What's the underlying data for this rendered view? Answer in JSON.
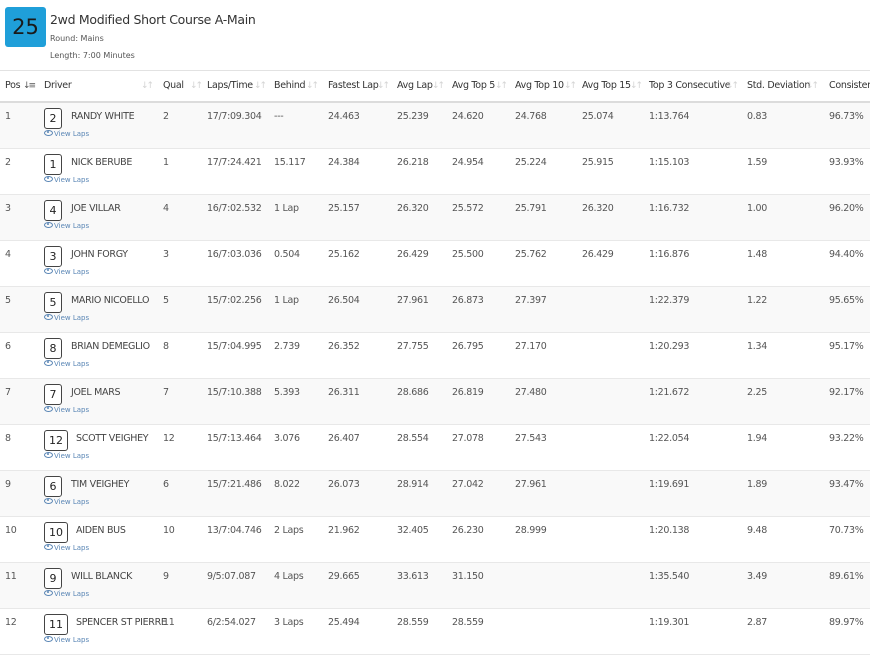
{
  "race": {
    "number": "25",
    "title": "2wd Modified Short Course A-Main",
    "round": "Round: Mains",
    "length": "Length: 7:00 Minutes"
  },
  "columns": {
    "pos": "Pos",
    "driver": "Driver",
    "qual": "Qual",
    "laps_time": "Laps/Time",
    "behind": "Behind",
    "fastest": "Fastest Lap",
    "avg_lap": "Avg Lap",
    "avg_top5": "Avg Top 5",
    "avg_top10": "Avg Top 10",
    "avg_top15": "Avg Top 15",
    "top3": "Top 3 Consecutive",
    "std_dev": "Std. Deviation",
    "consistency": "Consistency"
  },
  "view_laps_label": "View Laps",
  "rows": [
    {
      "pos": "1",
      "car": "2",
      "driver": "RANDY WHITE",
      "qual": "2",
      "laps_time": "17/7:09.304",
      "behind": "---",
      "fastest": "24.463",
      "avg_lap": "25.239",
      "avg_top5": "24.620",
      "avg_top10": "24.768",
      "avg_top15": "25.074",
      "top3": "1:13.764",
      "std_dev": "0.83",
      "consistency": "96.73%"
    },
    {
      "pos": "2",
      "car": "1",
      "driver": "NICK BERUBE",
      "qual": "1",
      "laps_time": "17/7:24.421",
      "behind": "15.117",
      "fastest": "24.384",
      "avg_lap": "26.218",
      "avg_top5": "24.954",
      "avg_top10": "25.224",
      "avg_top15": "25.915",
      "top3": "1:15.103",
      "std_dev": "1.59",
      "consistency": "93.93%"
    },
    {
      "pos": "3",
      "car": "4",
      "driver": "JOE VILLAR",
      "qual": "4",
      "laps_time": "16/7:02.532",
      "behind": "1 Lap",
      "fastest": "25.157",
      "avg_lap": "26.320",
      "avg_top5": "25.572",
      "avg_top10": "25.791",
      "avg_top15": "26.320",
      "top3": "1:16.732",
      "std_dev": "1.00",
      "consistency": "96.20%"
    },
    {
      "pos": "4",
      "car": "3",
      "driver": "JOHN FORGY",
      "qual": "3",
      "laps_time": "16/7:03.036",
      "behind": "0.504",
      "fastest": "25.162",
      "avg_lap": "26.429",
      "avg_top5": "25.500",
      "avg_top10": "25.762",
      "avg_top15": "26.429",
      "top3": "1:16.876",
      "std_dev": "1.48",
      "consistency": "94.40%"
    },
    {
      "pos": "5",
      "car": "5",
      "driver": "MARIO NICOELLO",
      "qual": "5",
      "laps_time": "15/7:02.256",
      "behind": "1 Lap",
      "fastest": "26.504",
      "avg_lap": "27.961",
      "avg_top5": "26.873",
      "avg_top10": "27.397",
      "avg_top15": "",
      "top3": "1:22.379",
      "std_dev": "1.22",
      "consistency": "95.65%"
    },
    {
      "pos": "6",
      "car": "8",
      "driver": "BRIAN DEMEGLIO",
      "qual": "8",
      "laps_time": "15/7:04.995",
      "behind": "2.739",
      "fastest": "26.352",
      "avg_lap": "27.755",
      "avg_top5": "26.795",
      "avg_top10": "27.170",
      "avg_top15": "",
      "top3": "1:20.293",
      "std_dev": "1.34",
      "consistency": "95.17%"
    },
    {
      "pos": "7",
      "car": "7",
      "driver": "JOEL MARS",
      "qual": "7",
      "laps_time": "15/7:10.388",
      "behind": "5.393",
      "fastest": "26.311",
      "avg_lap": "28.686",
      "avg_top5": "26.819",
      "avg_top10": "27.480",
      "avg_top15": "",
      "top3": "1:21.672",
      "std_dev": "2.25",
      "consistency": "92.17%"
    },
    {
      "pos": "8",
      "car": "12",
      "driver": "SCOTT VEIGHEY",
      "qual": "12",
      "laps_time": "15/7:13.464",
      "behind": "3.076",
      "fastest": "26.407",
      "avg_lap": "28.554",
      "avg_top5": "27.078",
      "avg_top10": "27.543",
      "avg_top15": "",
      "top3": "1:22.054",
      "std_dev": "1.94",
      "consistency": "93.22%"
    },
    {
      "pos": "9",
      "car": "6",
      "driver": "TIM VEIGHEY",
      "qual": "6",
      "laps_time": "15/7:21.486",
      "behind": "8.022",
      "fastest": "26.073",
      "avg_lap": "28.914",
      "avg_top5": "27.042",
      "avg_top10": "27.961",
      "avg_top15": "",
      "top3": "1:19.691",
      "std_dev": "1.89",
      "consistency": "93.47%"
    },
    {
      "pos": "10",
      "car": "10",
      "driver": "AIDEN BUS",
      "qual": "10",
      "laps_time": "13/7:04.746",
      "behind": "2 Laps",
      "fastest": "21.962",
      "avg_lap": "32.405",
      "avg_top5": "26.230",
      "avg_top10": "28.999",
      "avg_top15": "",
      "top3": "1:20.138",
      "std_dev": "9.48",
      "consistency": "70.73%"
    },
    {
      "pos": "11",
      "car": "9",
      "driver": "WILL BLANCK",
      "qual": "9",
      "laps_time": "9/5:07.087",
      "behind": "4 Laps",
      "fastest": "29.665",
      "avg_lap": "33.613",
      "avg_top5": "31.150",
      "avg_top10": "",
      "avg_top15": "",
      "top3": "1:35.540",
      "std_dev": "3.49",
      "consistency": "89.61%"
    },
    {
      "pos": "12",
      "car": "11",
      "driver": "SPENCER ST PIERRE",
      "qual": "11",
      "laps_time": "6/2:54.027",
      "behind": "3 Laps",
      "fastest": "25.494",
      "avg_lap": "28.559",
      "avg_top5": "28.559",
      "avg_top10": "",
      "avg_top15": "",
      "top3": "1:19.301",
      "std_dev": "2.87",
      "consistency": "89.97%"
    }
  ]
}
